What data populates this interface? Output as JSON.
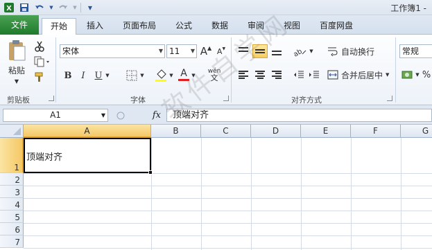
{
  "title_bar": {
    "workbook_title": "工作簿1 -",
    "qat_icons": [
      "excel-logo-icon",
      "save-icon",
      "undo-icon",
      "redo-icon",
      "customize-qat-icon"
    ]
  },
  "tabs": [
    {
      "label": "文件"
    },
    {
      "label": "开始"
    },
    {
      "label": "插入"
    },
    {
      "label": "页面布局"
    },
    {
      "label": "公式"
    },
    {
      "label": "数据"
    },
    {
      "label": "审阅"
    },
    {
      "label": "视图"
    },
    {
      "label": "百度网盘"
    }
  ],
  "ribbon": {
    "clipboard": {
      "paste_label": "粘贴",
      "group_label": "剪贴板"
    },
    "font": {
      "font_name": "宋体",
      "font_size": "11",
      "grow_glyph": "A",
      "shrink_glyph": "A",
      "bold_glyph": "B",
      "italic_glyph": "I",
      "underline_glyph": "U",
      "font_color_glyph": "A",
      "wen_glyph": "wén",
      "group_label": "字体"
    },
    "alignment": {
      "wrap_text_label": "自动换行",
      "merge_center_label": "合并后居中",
      "group_label": "对齐方式"
    },
    "number": {
      "format": "常规",
      "percent_glyph": "%"
    }
  },
  "formula_bar": {
    "name_box": "A1",
    "fx_label": "fx",
    "formula": "顶端对齐"
  },
  "sheet": {
    "columns": [
      "A",
      "B",
      "C",
      "D",
      "E",
      "F",
      "G"
    ],
    "rows": [
      "1",
      "2",
      "3",
      "4",
      "5",
      "6",
      "7"
    ],
    "selected_cell": "A1",
    "cells": {
      "A1": "顶端对齐"
    }
  },
  "watermark": {
    "text": "软件自学网"
  },
  "colors": {
    "file_tab": "#2e8b3a",
    "selection_header": "#f5c865",
    "ribbon_bg": "#edf2f9"
  }
}
